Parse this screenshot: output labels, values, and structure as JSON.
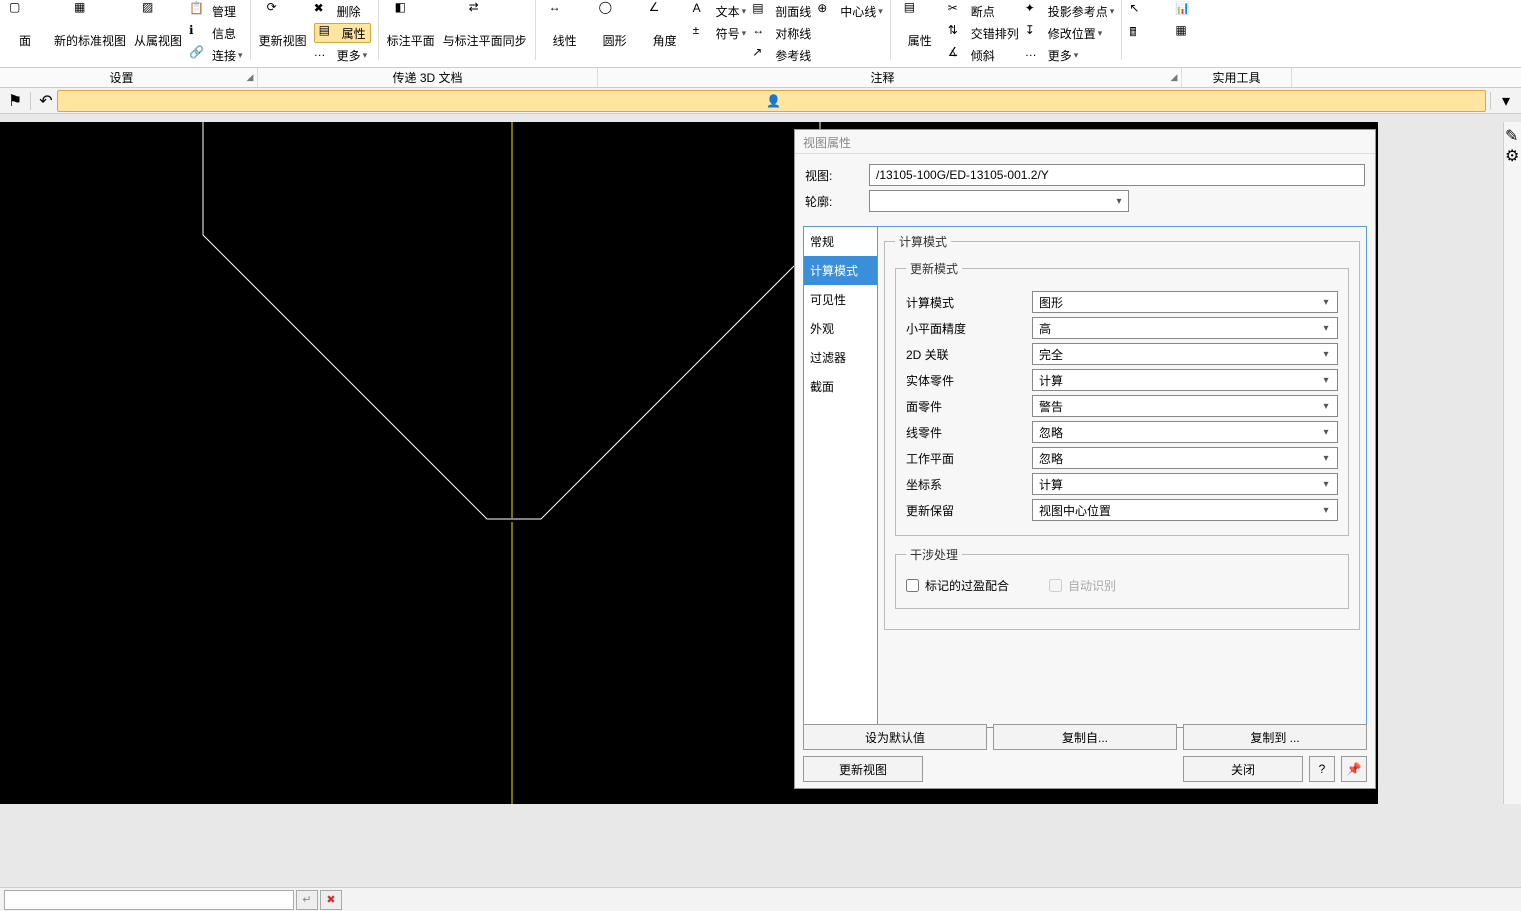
{
  "ribbon": {
    "btn_face": "面",
    "btn_new_std_view": "新的标准视图",
    "btn_sub_view": "从属视图",
    "sm_manage": "管理",
    "sm_info": "信息",
    "sm_connect": "连接",
    "btn_update_view": "更新视图",
    "sm_delete": "删除",
    "sm_props": "属性",
    "sm_more": "更多",
    "btn_anno_plane": "标注平面",
    "btn_sync_anno_plane": "与标注平面同步",
    "btn_linear": "线性",
    "btn_circular": "圆形",
    "btn_angle": "角度",
    "sm_text": "文本",
    "sm_symbol": "符号",
    "sm_section_line_a": "剖面线",
    "sm_center_line": "中心线",
    "sm_sym_line": "对称线",
    "sm_ref_line": "参考线",
    "btn_props2": "属性",
    "sm_breakpoint": "断点",
    "sm_stagger": "交错排列",
    "sm_tilt": "倾斜",
    "sm_proj_ref": "投影参考点",
    "sm_mod_pos": "修改位置",
    "sm_more2": "更多"
  },
  "groups": {
    "g_settings": "设置",
    "g_3d": "传递 3D 文档",
    "g_annot": "注释",
    "g_tools": "实用工具"
  },
  "dlg": {
    "title": "视图属性",
    "lbl_view": "视图:",
    "val_view": "/13105-100G/ED-13105-001.2/Y",
    "lbl_outline": "轮廓:",
    "tabs": {
      "general": "常规",
      "calc": "计算模式",
      "visibility": "可见性",
      "appearance": "外观",
      "filter": "过滤器",
      "section": "截面"
    },
    "fs_calc": "计算模式",
    "fs_update": "更新模式",
    "r_calc": "计算模式",
    "v_calc": "图形",
    "r_precision": "小平面精度",
    "v_precision": "高",
    "r_2d": "2D 关联",
    "v_2d": "完全",
    "r_solid": "实体零件",
    "v_solid": "计算",
    "r_face": "面零件",
    "v_face": "警告",
    "r_line": "线零件",
    "v_line": "忽略",
    "r_workplane": "工作平面",
    "v_workplane": "忽略",
    "r_cs": "坐标系",
    "v_cs": "计算",
    "r_keep": "更新保留",
    "v_keep": "视图中心位置",
    "fs_interf": "干涉处理",
    "chk_mark": "标记的过盈配合",
    "chk_auto": "自动识别",
    "btn_default": "设为默认值",
    "btn_copy_from": "复制自...",
    "btn_copy_to": "复制到 ...",
    "btn_update": "更新视图",
    "btn_close": "关闭"
  }
}
